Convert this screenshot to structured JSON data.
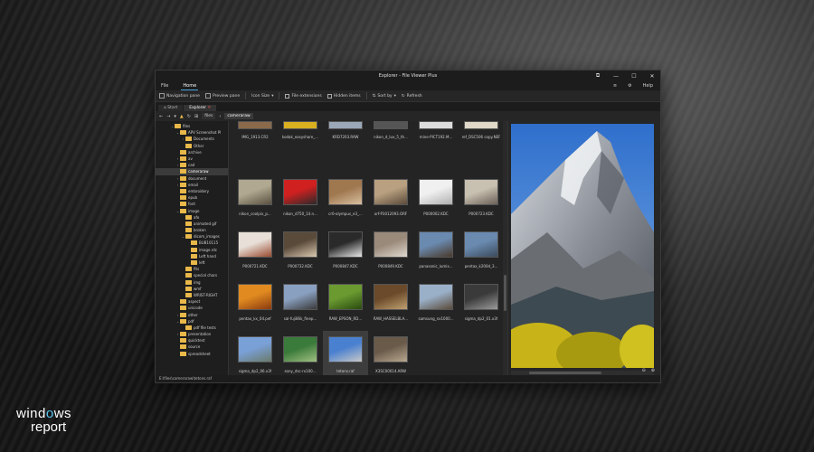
{
  "window": {
    "title": "Explorer - File Viewer Plus",
    "controls": [
      "⧉",
      "—",
      "☐",
      "✕"
    ]
  },
  "menu": {
    "items": [
      "File",
      "Home"
    ],
    "active": "Home",
    "right_items": [
      "≡",
      "⚙",
      "Help"
    ]
  },
  "ribbon": {
    "navigation_pane": "Navigation pane",
    "preview_pane": "Preview pane",
    "icon_size": "Icon Size",
    "file_extensions": "File extensions",
    "hidden_items": "Hidden items",
    "sort_by": "Sort by",
    "refresh": "Refresh"
  },
  "tabs": [
    {
      "label": "Start",
      "active": false
    },
    {
      "label": "Explorer",
      "active": true
    }
  ],
  "address": {
    "crumbs": [
      "files",
      "cameraraw"
    ]
  },
  "tree": [
    {
      "label": "files",
      "depth": 0,
      "tw": "⌄"
    },
    {
      "label": "APV Screenshot Pl",
      "depth": 1,
      "tw": "⌄"
    },
    {
      "label": "Documents",
      "depth": 2,
      "tw": "›"
    },
    {
      "label": "Other",
      "depth": 2,
      "tw": ""
    },
    {
      "label": "archive",
      "depth": 1,
      "tw": ""
    },
    {
      "label": "av",
      "depth": 1,
      "tw": "›"
    },
    {
      "label": "cad",
      "depth": 1,
      "tw": "›"
    },
    {
      "label": "cameraraw",
      "depth": 1,
      "tw": "",
      "selected": true
    },
    {
      "label": "document",
      "depth": 1,
      "tw": "›"
    },
    {
      "label": "email",
      "depth": 1,
      "tw": "›"
    },
    {
      "label": "embroidery",
      "depth": 1,
      "tw": ""
    },
    {
      "label": "epub",
      "depth": 1,
      "tw": ""
    },
    {
      "label": "font",
      "depth": 1,
      "tw": ""
    },
    {
      "label": "image",
      "depth": 1,
      "tw": "⌄"
    },
    {
      "label": "afo",
      "depth": 2,
      "tw": ""
    },
    {
      "label": "animated gif",
      "depth": 2,
      "tw": ""
    },
    {
      "label": "broken",
      "depth": 2,
      "tw": ""
    },
    {
      "label": "dicom_images",
      "depth": 2,
      "tw": "⌄"
    },
    {
      "label": "BUB10115",
      "depth": 3,
      "tw": ""
    },
    {
      "label": "image.rdc",
      "depth": 3,
      "tw": ""
    },
    {
      "label": "Left hand",
      "depth": 3,
      "tw": ""
    },
    {
      "label": "left",
      "depth": 3,
      "tw": ""
    },
    {
      "label": "fits",
      "depth": 2,
      "tw": ""
    },
    {
      "label": "special chars",
      "depth": 2,
      "tw": ""
    },
    {
      "label": "img",
      "depth": 2,
      "tw": ""
    },
    {
      "label": "wmf",
      "depth": 2,
      "tw": ""
    },
    {
      "label": "WRIST-RIGHT",
      "depth": 2,
      "tw": ""
    },
    {
      "label": "aspect",
      "depth": 1,
      "tw": ""
    },
    {
      "label": "unicode",
      "depth": 1,
      "tw": ""
    },
    {
      "label": "other",
      "depth": 1,
      "tw": "›"
    },
    {
      "label": "pdf",
      "depth": 1,
      "tw": "⌄"
    },
    {
      "label": "pdf file tests",
      "depth": 2,
      "tw": ""
    },
    {
      "label": "presentation",
      "depth": 1,
      "tw": "›"
    },
    {
      "label": "quicktest",
      "depth": 1,
      "tw": ""
    },
    {
      "label": "source",
      "depth": 1,
      "tw": ""
    },
    {
      "label": "spreadsheet",
      "depth": 1,
      "tw": ""
    }
  ],
  "files_top": [
    {
      "label": "IMG_1913.CR2",
      "color": "#8a6a4a"
    },
    {
      "label": "kodak_easyshare_...",
      "color": "#d8b020"
    },
    {
      "label": "KRD7203.RAW",
      "color": "#9aa8b8"
    },
    {
      "label": "nikon_d_lux_5_th...",
      "color": "#555"
    },
    {
      "label": "mine-PICT192.M...",
      "color": "#ddd"
    },
    {
      "label": "ref_DSC506 copy.NEF",
      "color": "#e0d8c8"
    }
  ],
  "files": [
    {
      "label": "nikon_coolpix_p...",
      "c1": "#b0a890",
      "c2": "#5a5040"
    },
    {
      "label": "nikon_d750_14.n...",
      "c1": "#d02020",
      "c2": "#2a2a2a"
    },
    {
      "label": "cr0-olympus_e3_...",
      "c1": "#a07850",
      "c2": "#d8c0a0"
    },
    {
      "label": "orf-P3012093.ORF",
      "c1": "#b8a080",
      "c2": "#5a4a3a"
    },
    {
      "label": "P000002.KDC",
      "c1": "#f0f0f0",
      "c2": "#b0b0b0"
    },
    {
      "label": "P000723.KDC",
      "c1": "#c8c0b0",
      "c2": "#6a6058"
    },
    {
      "label": "P000721.KDC",
      "c1": "#e8e0d8",
      "c2": "#9a4a30"
    },
    {
      "label": "P000732.KDC",
      "c1": "#5a4a3a",
      "c2": "#d8c8b0"
    },
    {
      "label": "P000847.KDC",
      "c1": "#2a2a2a",
      "c2": "#e8e8e8"
    },
    {
      "label": "P000849.KDC",
      "c1": "#9a8a7a",
      "c2": "#e0d8d0"
    },
    {
      "label": "panasonic_lumix...",
      "c1": "#6a8ab0",
      "c2": "#4a3a2a"
    },
    {
      "label": "pentax_k200d_3...",
      "c1": "#6a8ab0",
      "c2": "#3a4a5a"
    },
    {
      "label": "pentax_kx_04.pef",
      "c1": "#e08a20",
      "c2": "#8a3a10"
    },
    {
      "label": "sal-fuji86k_finep...",
      "c1": "#8aa0c0",
      "c2": "#3a3a3a"
    },
    {
      "label": "RAW_EPSON_RD...",
      "c1": "#6a9a30",
      "c2": "#2a4a10"
    },
    {
      "label": "RAW_HASSELBLA...",
      "c1": "#6a4a2a",
      "c2": "#c0a070"
    },
    {
      "label": "samsung_nx1000...",
      "c1": "#9ab0c8",
      "c2": "#5a4a3a"
    },
    {
      "label": "sigma_dp2_01.x3f",
      "c1": "#3a3a3a",
      "c2": "#9a9a9a"
    },
    {
      "label": "sigma_dp2_06.x3f",
      "c1": "#7aa0d8",
      "c2": "#6a7a6a"
    },
    {
      "label": "sony_dsc-rx100...",
      "c1": "#3a7a3a",
      "c2": "#a0c080"
    },
    {
      "label": "tetons.raf",
      "c1": "#4a80d0",
      "c2": "#c8c8c8",
      "selected": true
    },
    {
      "label": "X3SC00014.ARW",
      "c1": "#6a5a4a",
      "c2": "#b8a890"
    }
  ],
  "preview": {
    "zoom_out": "⊖",
    "zoom_in": "⊕",
    "zoom_level": "100%"
  },
  "status": {
    "path": "E:\\files\\cameraraw\\tetons.raf"
  },
  "brand": {
    "line1_a": "wind",
    "line1_b": "o",
    "line1_c": "ws",
    "line2": "report"
  }
}
